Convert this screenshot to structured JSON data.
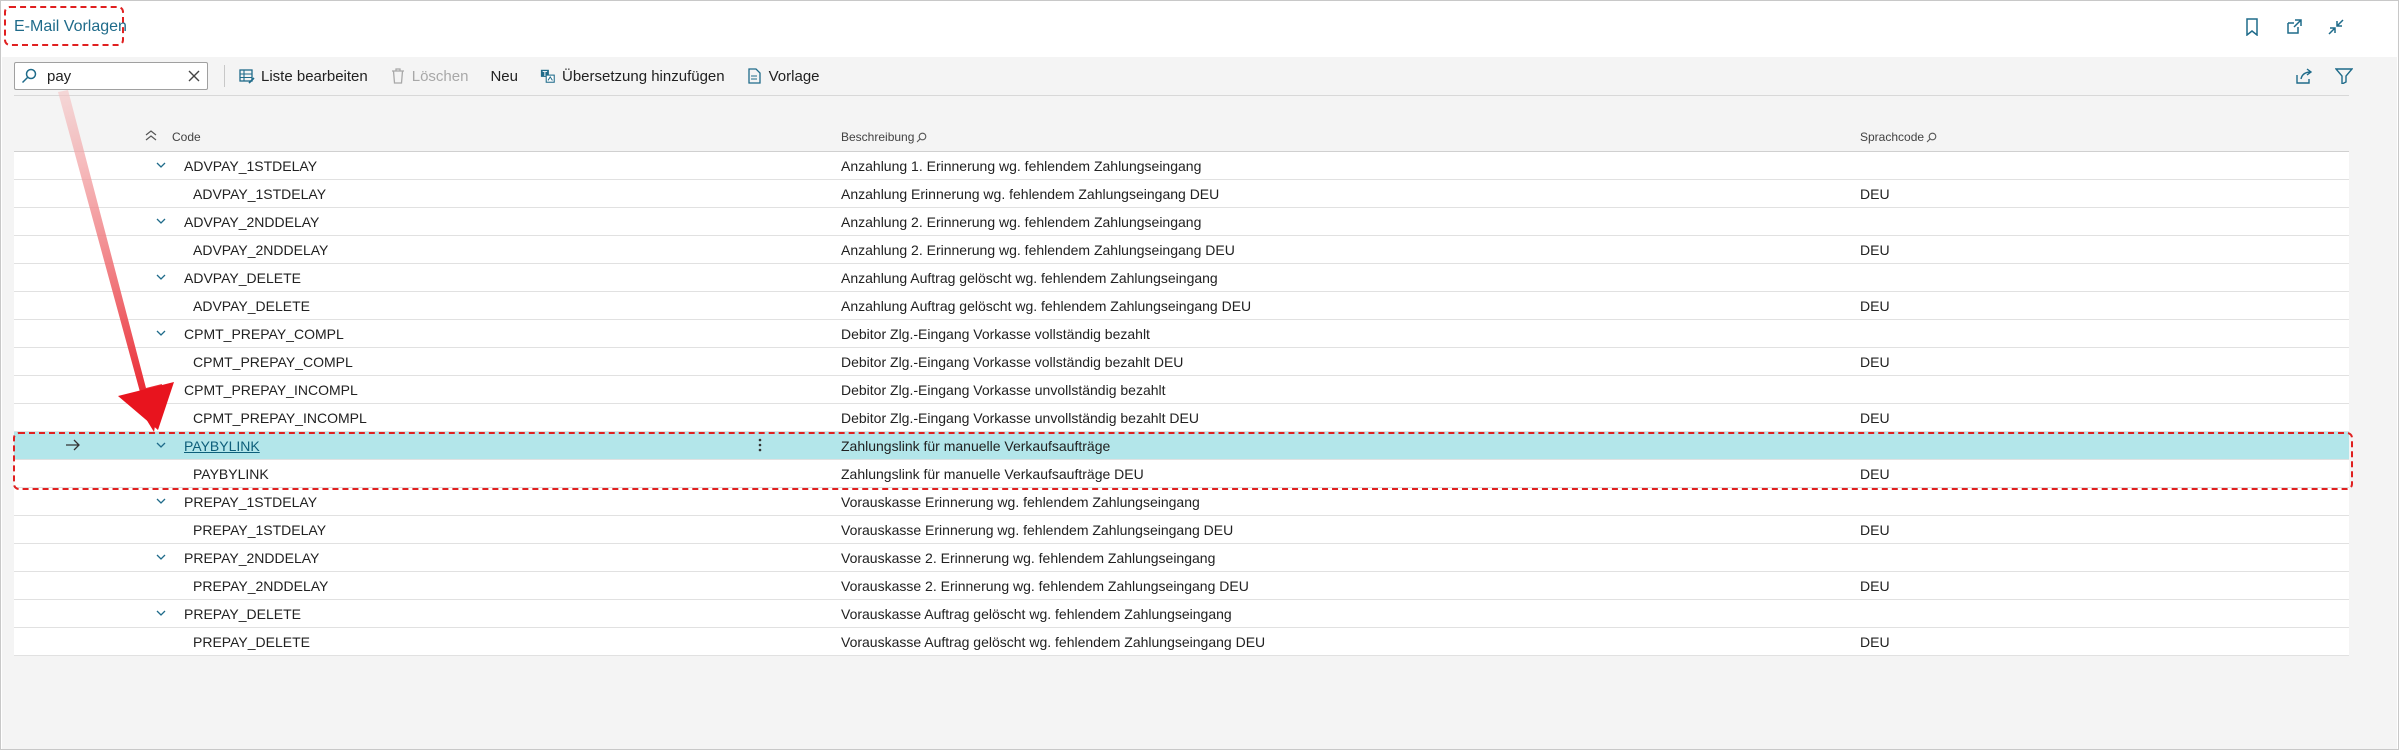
{
  "page": {
    "title": "E-Mail Vorlagen"
  },
  "search": {
    "value": "pay"
  },
  "toolbar": {
    "edit_list": "Liste bearbeiten",
    "delete": "Löschen",
    "new": "Neu",
    "add_translation": "Übersetzung hinzufügen",
    "template": "Vorlage"
  },
  "columns": {
    "code": "Code",
    "description": "Beschreibung",
    "language": "Sprachcode"
  },
  "rows": [
    {
      "code": "ADVPAY_1STDELAY",
      "desc": "Anzahlung 1. Erinnerung wg. fehlendem Zahlungseingang",
      "lang": ""
    },
    {
      "code": "ADVPAY_1STDELAY",
      "desc": "Anzahlung Erinnerung wg. fehlendem Zahlungseingang DEU",
      "lang": "DEU"
    },
    {
      "code": "ADVPAY_2NDDELAY",
      "desc": "Anzahlung 2. Erinnerung wg. fehlendem Zahlungseingang",
      "lang": ""
    },
    {
      "code": "ADVPAY_2NDDELAY",
      "desc": "Anzahlung 2. Erinnerung wg. fehlendem Zahlungseingang DEU",
      "lang": "DEU"
    },
    {
      "code": "ADVPAY_DELETE",
      "desc": "Anzahlung Auftrag gelöscht wg. fehlendem Zahlungseingang",
      "lang": ""
    },
    {
      "code": "ADVPAY_DELETE",
      "desc": "Anzahlung Auftrag gelöscht wg. fehlendem Zahlungseingang DEU",
      "lang": "DEU"
    },
    {
      "code": "CPMT_PREPAY_COMPL",
      "desc": "Debitor Zlg.-Eingang Vorkasse vollständig bezahlt",
      "lang": ""
    },
    {
      "code": "CPMT_PREPAY_COMPL",
      "desc": "Debitor Zlg.-Eingang Vorkasse vollständig bezahlt DEU",
      "lang": "DEU"
    },
    {
      "code": "CPMT_PREPAY_INCOMPL",
      "desc": "Debitor Zlg.-Eingang Vorkasse unvollständig bezahlt",
      "lang": ""
    },
    {
      "code": "CPMT_PREPAY_INCOMPL",
      "desc": "Debitor Zlg.-Eingang Vorkasse unvollständig bezahlt DEU",
      "lang": "DEU"
    },
    {
      "code": "PAYBYLINK",
      "desc": "Zahlungslink für manuelle Verkaufsaufträge",
      "lang": ""
    },
    {
      "code": "PAYBYLINK",
      "desc": "Zahlungslink für manuelle Verkaufsaufträge DEU",
      "lang": "DEU"
    },
    {
      "code": "PREPAY_1STDELAY",
      "desc": "Vorauskasse Erinnerung wg. fehlendem Zahlungseingang",
      "lang": ""
    },
    {
      "code": "PREPAY_1STDELAY",
      "desc": "Vorauskasse Erinnerung wg. fehlendem Zahlungseingang DEU",
      "lang": "DEU"
    },
    {
      "code": "PREPAY_2NDDELAY",
      "desc": "Vorauskasse 2. Erinnerung wg. fehlendem Zahlungseingang",
      "lang": ""
    },
    {
      "code": "PREPAY_2NDDELAY",
      "desc": "Vorauskasse 2. Erinnerung wg. fehlendem Zahlungseingang DEU",
      "lang": "DEU"
    },
    {
      "code": "PREPAY_DELETE",
      "desc": "Vorauskasse Auftrag gelöscht wg. fehlendem Zahlungseingang",
      "lang": ""
    },
    {
      "code": "PREPAY_DELETE",
      "desc": "Vorauskasse Auftrag gelöscht wg. fehlendem Zahlungseingang DEU",
      "lang": "DEU"
    }
  ],
  "colors": {
    "accent": "#1f6b8a",
    "selected_row": "#b3e6ea",
    "highlight": "#e02020"
  }
}
